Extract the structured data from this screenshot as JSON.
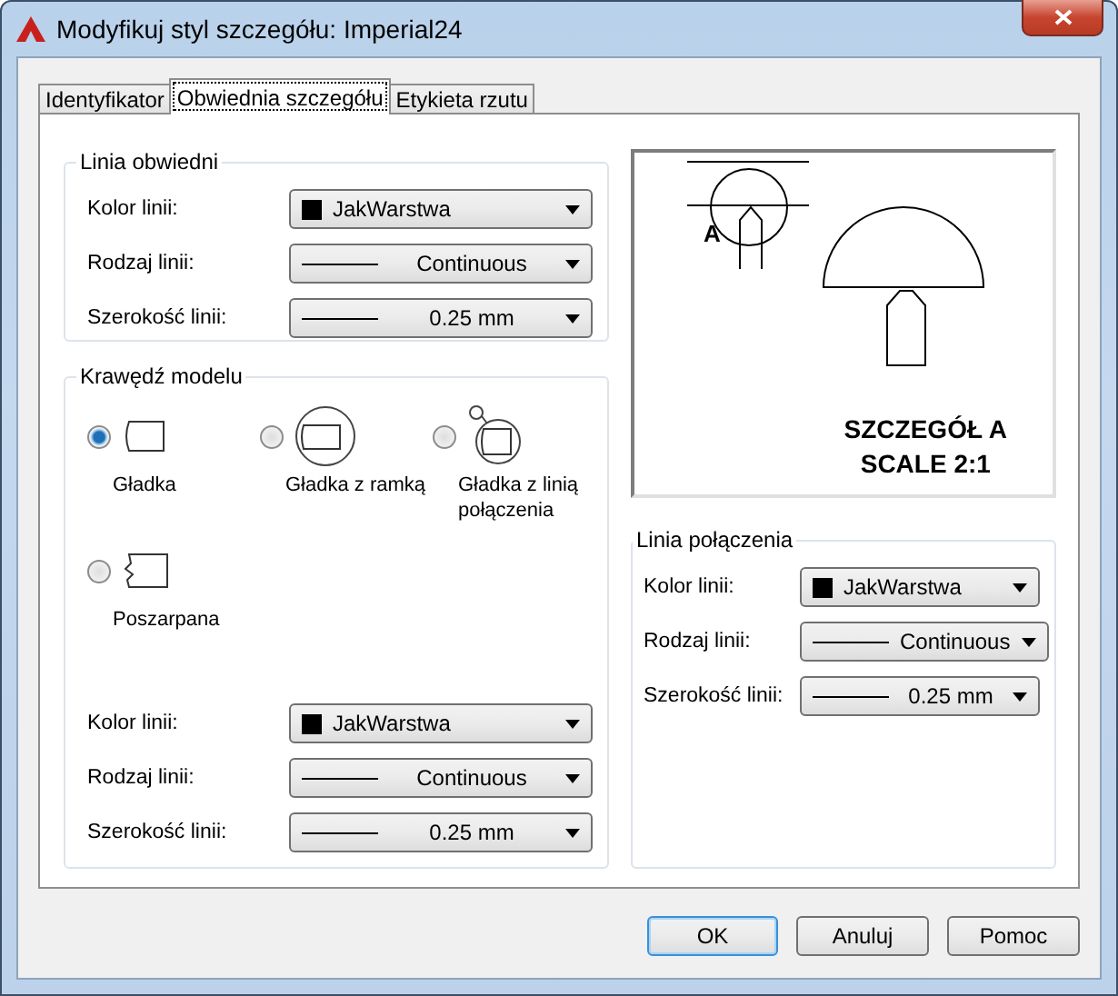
{
  "window": {
    "title": "Modyfikuj styl szczegółu: Imperial24"
  },
  "tabs": [
    {
      "label": "Identyfikator",
      "selected": false
    },
    {
      "label": "Obwiednia szczegółu",
      "selected": true
    },
    {
      "label": "Etykieta rzutu",
      "selected": false
    }
  ],
  "boundary_group": {
    "title": "Linia obwiedni",
    "fields": [
      {
        "label": "Kolor linii:",
        "kind": "color",
        "value": "JakWarstwa"
      },
      {
        "label": "Rodzaj linii:",
        "kind": "line",
        "value": "Continuous"
      },
      {
        "label": "Szerokość linii:",
        "kind": "line",
        "value": "0.25 mm"
      }
    ]
  },
  "model_edge_group": {
    "title": "Krawędź modelu",
    "options": [
      {
        "label": "Gładka",
        "kind": "smooth",
        "selected": true
      },
      {
        "label": "Gładka z ramką",
        "kind": "framed",
        "selected": false
      },
      {
        "label": "Gładka z linią połączenia",
        "kind": "connected",
        "selected": false
      },
      {
        "label": "Poszarpana",
        "kind": "jagged",
        "selected": false
      }
    ],
    "fields": [
      {
        "label": "Kolor linii:",
        "kind": "color",
        "value": "JakWarstwa"
      },
      {
        "label": "Rodzaj linii:",
        "kind": "line",
        "value": "Continuous"
      },
      {
        "label": "Szerokość linii:",
        "kind": "line",
        "value": "0.25 mm"
      }
    ]
  },
  "preview": {
    "marker": "A",
    "caption_lines": [
      "SZCZEGÓŁ A",
      "SCALE 2:1"
    ]
  },
  "connection_group": {
    "title": "Linia połączenia",
    "fields": [
      {
        "label": "Kolor linii:",
        "kind": "color",
        "value": "JakWarstwa"
      },
      {
        "label": "Rodzaj linii:",
        "kind": "line",
        "value": "Continuous"
      },
      {
        "label": "Szerokość linii:",
        "kind": "line",
        "value": "0.25 mm"
      }
    ]
  },
  "buttons": [
    {
      "label": "OK",
      "default": true
    },
    {
      "label": "Anuluj",
      "default": false
    },
    {
      "label": "Pomoc",
      "default": false
    }
  ]
}
